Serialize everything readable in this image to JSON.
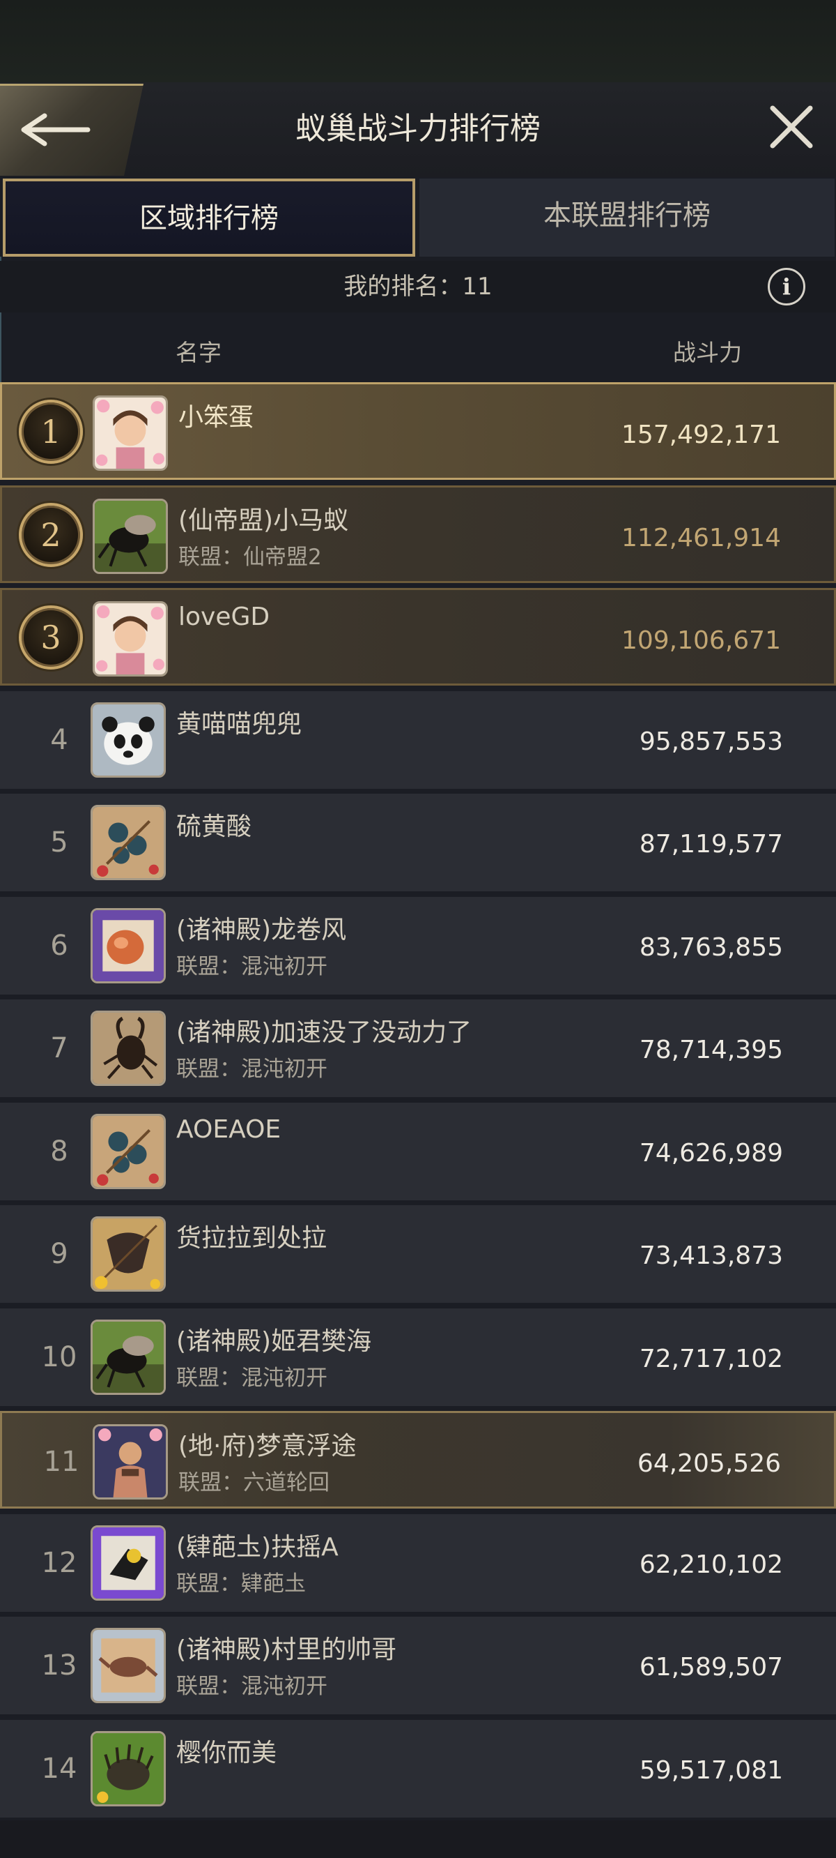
{
  "header": {
    "title": "蚁巢战斗力排行榜"
  },
  "tabs": [
    {
      "label": "区域排行榜",
      "active": true
    },
    {
      "label": "本联盟排行榜",
      "active": false
    }
  ],
  "my_rank": {
    "label": "我的排名：",
    "value": "11"
  },
  "columns": {
    "name": "名字",
    "power": "战斗力"
  },
  "alliance_prefix": "联盟：",
  "rows": [
    {
      "rank": "1",
      "name": "小笨蛋",
      "alliance": "",
      "power": "157,492,171",
      "avatar": "portrait-flowers"
    },
    {
      "rank": "2",
      "name": "(仙帝盟)小马蚁",
      "alliance": "仙帝盟2",
      "power": "112,461,914",
      "avatar": "beetle"
    },
    {
      "rank": "3",
      "name": "loveGD",
      "alliance": "",
      "power": "109,106,671",
      "avatar": "portrait-flowers"
    },
    {
      "rank": "4",
      "name": "黄喵喵兜兜",
      "alliance": "",
      "power": "95,857,553",
      "avatar": "panda"
    },
    {
      "rank": "5",
      "name": "硫黄酸",
      "alliance": "",
      "power": "87,119,577",
      "avatar": "insects"
    },
    {
      "rank": "6",
      "name": "(诸神殿)龙卷风",
      "alliance": "混沌初开",
      "power": "83,763,855",
      "avatar": "larva"
    },
    {
      "rank": "7",
      "name": "(诸神殿)加速没了没动力了",
      "alliance": "混沌初开",
      "power": "78,714,395",
      "avatar": "stag-beetle"
    },
    {
      "rank": "8",
      "name": "AOEAOE",
      "alliance": "",
      "power": "74,626,989",
      "avatar": "insects"
    },
    {
      "rank": "9",
      "name": "货拉拉到处拉",
      "alliance": "",
      "power": "73,413,873",
      "avatar": "bat"
    },
    {
      "rank": "10",
      "name": "(诸神殿)姬君樊海",
      "alliance": "混沌初开",
      "power": "72,717,102",
      "avatar": "beetle"
    },
    {
      "rank": "11",
      "name": "(地·府)梦意浮途",
      "alliance": "六道轮回",
      "power": "64,205,526",
      "avatar": "warrior"
    },
    {
      "rank": "12",
      "name": "(肄葩圡)扶摇A",
      "alliance": "肄葩圡",
      "power": "62,210,102",
      "avatar": "bird"
    },
    {
      "rank": "13",
      "name": "(诸神殿)村里的帅哥",
      "alliance": "混沌初开",
      "power": "61,589,507",
      "avatar": "lizard"
    },
    {
      "rank": "14",
      "name": "樱你而美",
      "alliance": "",
      "power": "59,517,081",
      "avatar": "hedgehog"
    }
  ],
  "colors": {
    "accent_gold": "#bea26a",
    "row_bg": "#2b2d34",
    "page_bg": "#1b1d24"
  }
}
